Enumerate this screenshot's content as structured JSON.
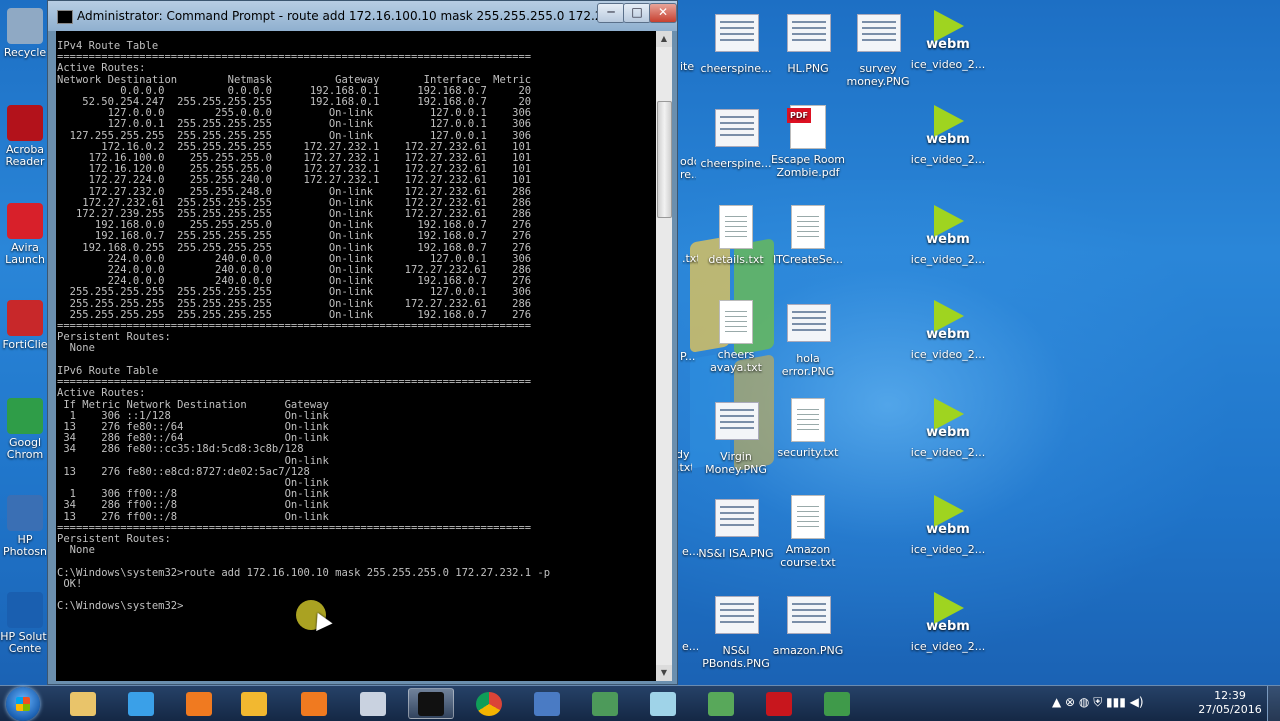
{
  "window": {
    "title": "Administrator: Command Prompt - route  add 172.16.100.10 mask 255.255.255.0 172.27.232.1 -p",
    "minimize": "─",
    "maximize": "□",
    "close": "✕"
  },
  "console_text": "IPv4 Route Table\n===========================================================================\nActive Routes:\nNetwork Destination        Netmask          Gateway       Interface  Metric\n          0.0.0.0          0.0.0.0      192.168.0.1      192.168.0.7     20\n    52.50.254.247  255.255.255.255      192.168.0.1      192.168.0.7     20\n        127.0.0.0        255.0.0.0         On-link         127.0.0.1    306\n        127.0.0.1  255.255.255.255         On-link         127.0.0.1    306\n  127.255.255.255  255.255.255.255         On-link         127.0.0.1    306\n       172.16.0.2  255.255.255.255     172.27.232.1    172.27.232.61    101\n     172.16.100.0    255.255.255.0     172.27.232.1    172.27.232.61    101\n     172.16.120.0    255.255.255.0     172.27.232.1    172.27.232.61    101\n     172.27.224.0    255.255.240.0     172.27.232.1    172.27.232.61    101\n     172.27.232.0    255.255.248.0         On-link     172.27.232.61    286\n    172.27.232.61  255.255.255.255         On-link     172.27.232.61    286\n   172.27.239.255  255.255.255.255         On-link     172.27.232.61    286\n      192.168.0.0    255.255.255.0         On-link       192.168.0.7    276\n      192.168.0.7  255.255.255.255         On-link       192.168.0.7    276\n    192.168.0.255  255.255.255.255         On-link       192.168.0.7    276\n        224.0.0.0        240.0.0.0         On-link         127.0.0.1    306\n        224.0.0.0        240.0.0.0         On-link     172.27.232.61    286\n        224.0.0.0        240.0.0.0         On-link       192.168.0.7    276\n  255.255.255.255  255.255.255.255         On-link         127.0.0.1    306\n  255.255.255.255  255.255.255.255         On-link     172.27.232.61    286\n  255.255.255.255  255.255.255.255         On-link       192.168.0.7    276\n===========================================================================\nPersistent Routes:\n  None\n\nIPv6 Route Table\n===========================================================================\nActive Routes:\n If Metric Network Destination      Gateway\n  1    306 ::1/128                  On-link\n 13    276 fe80::/64                On-link\n 34    286 fe80::/64                On-link\n 34    286 fe80::cc35:18d:5cd8:3c8b/128\n                                    On-link\n 13    276 fe80::e8cd:8727:de02:5ac7/128\n                                    On-link\n  1    306 ff00::/8                 On-link\n 34    286 ff00::/8                 On-link\n 13    276 ff00::/8                 On-link\n===========================================================================\nPersistent Routes:\n  None\n\nC:\\Windows\\system32>route add 172.16.100.10 mask 255.255.255.0 172.27.232.1 -p\n OK!\n\nC:\\Windows\\system32>",
  "left_desktop_icons": [
    {
      "label": "Recycle",
      "icon": "recycle-bin-icon",
      "color": "#8fa9c4"
    },
    {
      "label": "Acroba Reader",
      "icon": "acrobat-icon",
      "color": "#b3121b"
    },
    {
      "label": "Avira Launch",
      "icon": "avira-icon",
      "color": "#d8202a"
    },
    {
      "label": "FortiClie",
      "icon": "forticlient-icon",
      "color": "#c8282a"
    },
    {
      "label": "Googl Chrom",
      "icon": "chrome-icon",
      "color": "#2f9d48"
    },
    {
      "label": "HP Photosn",
      "icon": "hp-photosmart-icon",
      "color": "#3a6fb4"
    },
    {
      "label": "HP Soluti Cente",
      "icon": "hp-solution-center-icon",
      "color": "#1a5fb0"
    }
  ],
  "right_desktop_icons": [
    {
      "label": "cheerspine...",
      "kind": "thumb"
    },
    {
      "label": "HL.PNG",
      "kind": "thumb"
    },
    {
      "label": "survey money.PNG",
      "kind": "thumb"
    },
    {
      "label": "ice_video_2...",
      "kind": "webm"
    },
    {
      "label": "cheerspine...",
      "kind": "thumb"
    },
    {
      "label": "Escape Room Zombie.pdf",
      "kind": "pdf"
    },
    {
      "label": "ice_video_2...",
      "kind": "webm"
    },
    {
      "label": "details.txt",
      "kind": "doc"
    },
    {
      "label": "ITCreateSe...",
      "kind": "doc"
    },
    {
      "label": "ice_video_2...",
      "kind": "webm"
    },
    {
      "label": "cheers avaya.txt",
      "kind": "doc"
    },
    {
      "label": "hola error.PNG",
      "kind": "thumb"
    },
    {
      "label": "ice_video_2...",
      "kind": "webm"
    },
    {
      "label": "Virgin Money.PNG",
      "kind": "thumb"
    },
    {
      "label": "security.txt",
      "kind": "doc"
    },
    {
      "label": "ice_video_2...",
      "kind": "webm"
    },
    {
      "label": "NS&I ISA.PNG",
      "kind": "thumb"
    },
    {
      "label": "Amazon course.txt",
      "kind": "doc"
    },
    {
      "label": "ice_video_2...",
      "kind": "webm"
    },
    {
      "label": "NS&I PBonds.PNG",
      "kind": "thumb"
    },
    {
      "label": "amazon.PNG",
      "kind": "thumb"
    },
    {
      "label": "ice_video_2...",
      "kind": "webm"
    }
  ],
  "partial_labels": [
    "ite",
    "odo re...",
    ".txt",
    "P...",
    "dy .txt",
    "e...",
    "e...",
    "e..."
  ],
  "webm_text": "webm",
  "pdf_badge": "PDF",
  "taskbar": {
    "apps": [
      {
        "name": "explorer-icon",
        "color": "#e9c46a"
      },
      {
        "name": "internet-explorer-icon",
        "color": "#3aa0e8"
      },
      {
        "name": "orange-app-icon",
        "color": "#f07a20"
      },
      {
        "name": "outlook-icon",
        "color": "#f2b830"
      },
      {
        "name": "camera-app-icon",
        "color": "#f07a20"
      },
      {
        "name": "lock-app-icon",
        "color": "#c9d2e0"
      },
      {
        "name": "command-prompt-icon",
        "color": "#111111"
      },
      {
        "name": "chrome-icon",
        "color": "#2f9d48"
      },
      {
        "name": "network-app-icon",
        "color": "#4a7bc4"
      },
      {
        "name": "n-app-icon",
        "color": "#4d9a5a"
      },
      {
        "name": "crystal-app-icon",
        "color": "#9fd3e8"
      },
      {
        "name": "recycle-app-icon",
        "color": "#58a85a"
      },
      {
        "name": "acrobat-app-icon",
        "color": "#c8161d"
      },
      {
        "name": "chart-app-icon",
        "color": "#3f9a4a"
      }
    ],
    "tray_icons": "▲  ⊗  ◍  ⛨  ▮▮▮  ◀)",
    "clock_time": "12:39",
    "clock_date": "27/05/2016"
  }
}
